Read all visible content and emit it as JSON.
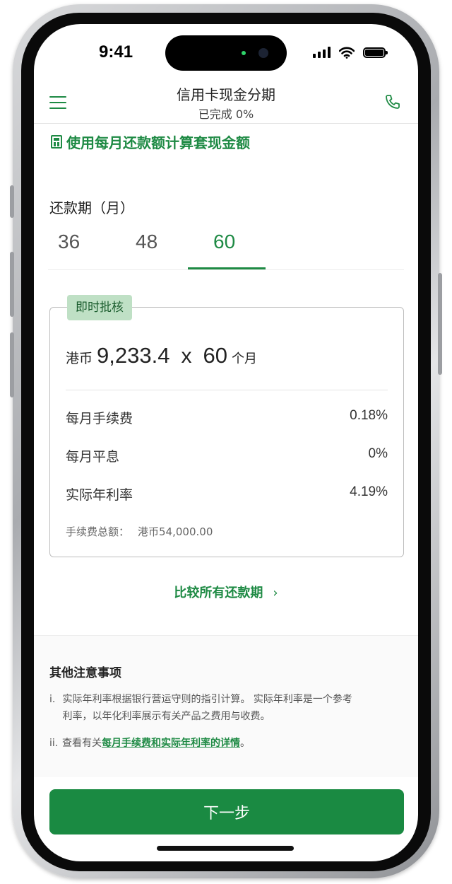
{
  "status_bar": {
    "time": "9:41"
  },
  "header": {
    "title": "信用卡现金分期",
    "progress": "已完成 0%"
  },
  "calculator": {
    "title": "使用每月还款额计算套现金额"
  },
  "period": {
    "label": "还款期（月）",
    "options": [
      "36",
      "48",
      "60"
    ],
    "selected": "60"
  },
  "card": {
    "badge": "即时批核",
    "currency": "港币",
    "monthly_amount": "9,233.4",
    "multiplier": "x",
    "months": "60",
    "months_unit": "个月",
    "rows": [
      {
        "label": "每月手续费",
        "value": "0.18%"
      },
      {
        "label": "每月平息",
        "value": "0%"
      },
      {
        "label": "实际年利率",
        "value": "4.19%"
      }
    ],
    "total_label": "手续费总额：",
    "total_value": "港币54,000.00"
  },
  "compare_link": "比较所有还款期",
  "notes": {
    "title": "其他注意事项",
    "items": [
      {
        "num": "i.",
        "line1": "实际年利率根据银行营运守则的指引计算。 实际年利率是一个参考",
        "line2": "利率，以年化利率展示有关产品之费用与收费。"
      },
      {
        "num": "ii.",
        "prefix": "查看有关",
        "link": "每月手续费和实际年利率的详情",
        "suffix": "。"
      }
    ]
  },
  "next_button": "下一步",
  "colors": {
    "brand_green": "#1a8a42",
    "badge_bg": "#bfe0c5"
  }
}
